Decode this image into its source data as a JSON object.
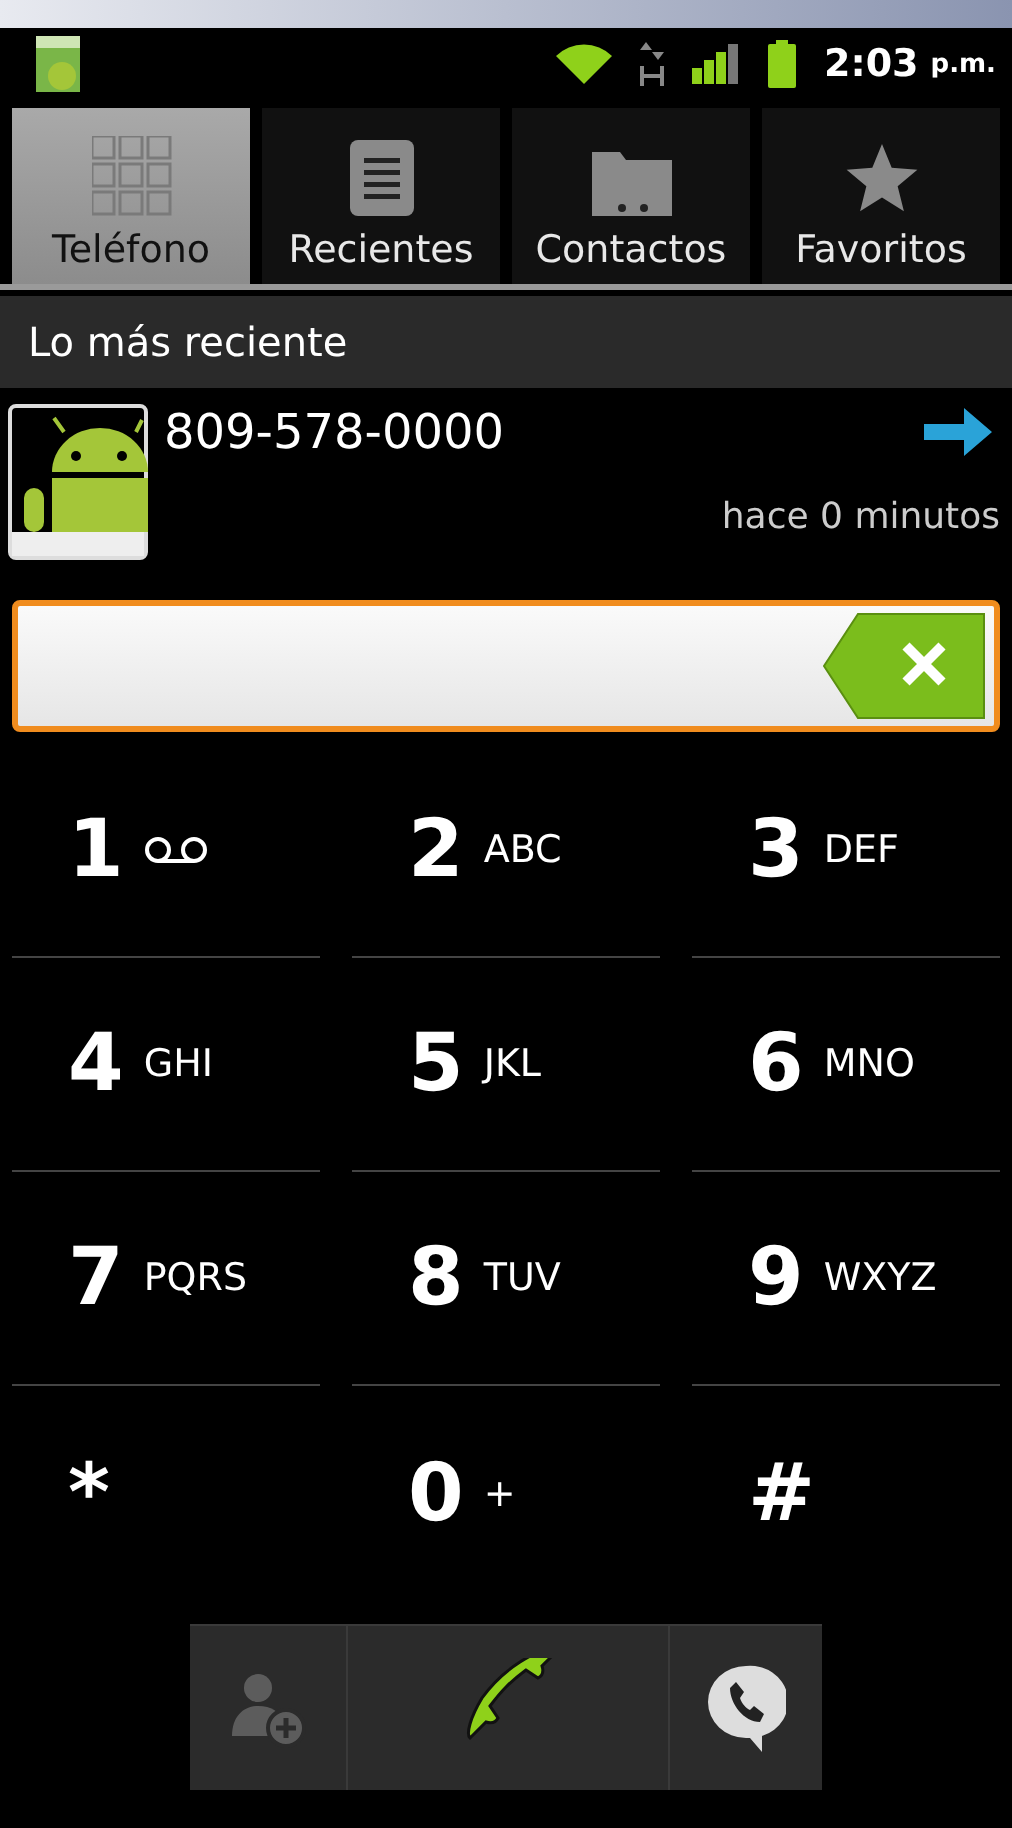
{
  "status_bar": {
    "time": "2:03",
    "period": "p.m."
  },
  "tabs": [
    {
      "label": "Teléfono",
      "kind": "keypad",
      "selected": true
    },
    {
      "label": "Recientes",
      "kind": "list",
      "selected": false
    },
    {
      "label": "Contactos",
      "kind": "folder",
      "selected": false
    },
    {
      "label": "Favoritos",
      "kind": "star",
      "selected": false
    }
  ],
  "section_header": "Lo más reciente",
  "recent": {
    "number": "809-578-0000",
    "time": "hace 0 minutos"
  },
  "keys": [
    {
      "digit": "1",
      "kind": "voicemail"
    },
    {
      "digit": "2",
      "kind": "letters",
      "letters": "ABC"
    },
    {
      "digit": "3",
      "kind": "letters",
      "letters": "DEF"
    },
    {
      "digit": "4",
      "kind": "letters",
      "letters": "GHI"
    },
    {
      "digit": "5",
      "kind": "letters",
      "letters": "JKL"
    },
    {
      "digit": "6",
      "kind": "letters",
      "letters": "MNO"
    },
    {
      "digit": "7",
      "kind": "letters",
      "letters": "PQRS"
    },
    {
      "digit": "8",
      "kind": "letters",
      "letters": "TUV"
    },
    {
      "digit": "9",
      "kind": "letters",
      "letters": "WXYZ"
    },
    {
      "digit": "*",
      "kind": "plain"
    },
    {
      "digit": "0",
      "kind": "letters",
      "letters": "+"
    },
    {
      "digit": "#",
      "kind": "plain"
    }
  ],
  "actions": {
    "add_contact_disabled": true
  }
}
